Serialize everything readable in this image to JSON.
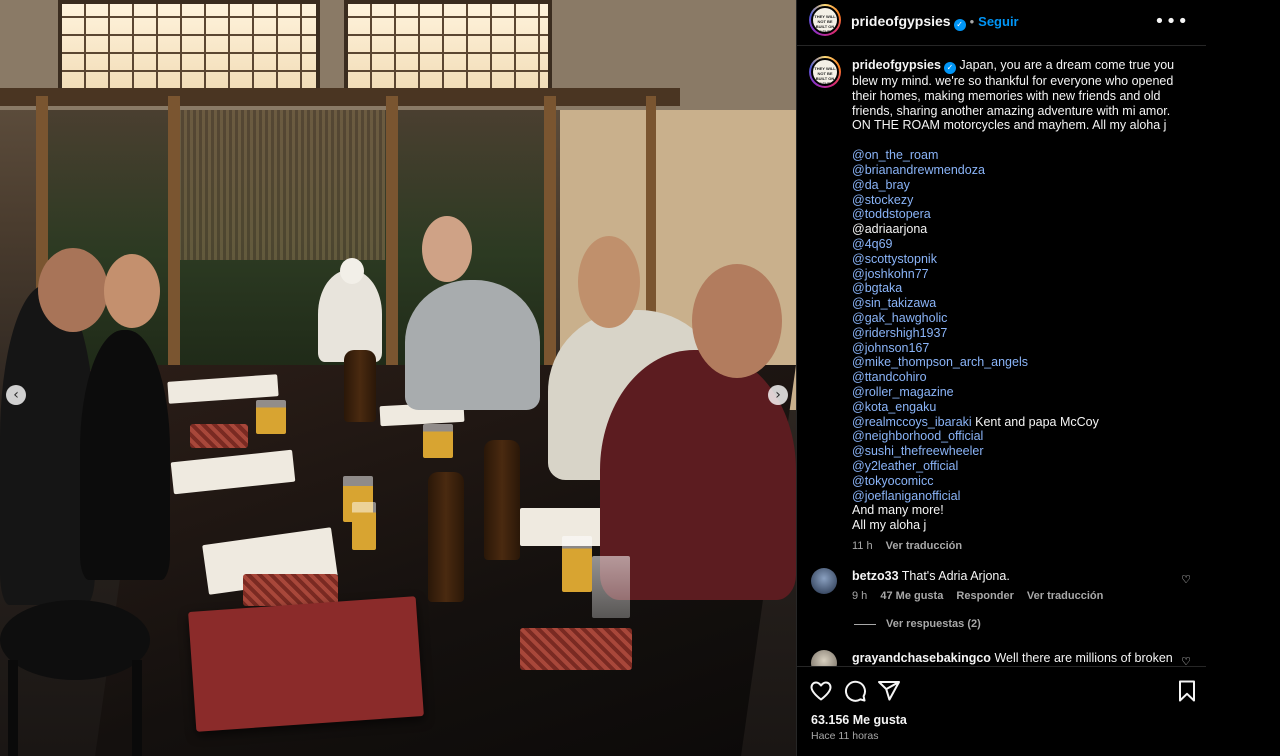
{
  "post": {
    "author": "prideofgypsies",
    "follow_label": "Seguir",
    "dot": "•",
    "more_label": "•••",
    "avatar_text": "THEY WILL NOT BE BUILT ON HASHED MACHINES",
    "verified_mark": "✓",
    "caption_text": "Japan, you are a dream come true you blew my mind. we're so thankful for everyone who opened their homes, making memories with new friends and old friends, sharing another amazing adventure with mi amor. ON THE ROAM motorcycles and mayhem. All my aloha j",
    "mention_lines": [
      {
        "text": "@on_the_roam",
        "type": "mention"
      },
      {
        "text": "@brianandrewmendoza",
        "type": "mention"
      },
      {
        "text": "@da_bray",
        "type": "mention"
      },
      {
        "text": "@stockezy",
        "type": "mention"
      },
      {
        "text": "@toddstopera",
        "type": "mention"
      },
      {
        "text": "@adriaarjona",
        "type": "plain"
      },
      {
        "text": "@4q69",
        "type": "mention"
      },
      {
        "text": "@scottystopnik",
        "type": "mention"
      },
      {
        "text": "@joshkohn77",
        "type": "mention"
      },
      {
        "text": "@bgtaka",
        "type": "mention"
      },
      {
        "text": "@sin_takizawa",
        "type": "mention"
      },
      {
        "text": "@gak_hawgholic",
        "type": "mention"
      },
      {
        "text": "@ridershigh1937",
        "type": "mention"
      },
      {
        "text": "@johnson167",
        "type": "mention"
      },
      {
        "text": "@mike_thompson_arch_angels",
        "type": "mention"
      },
      {
        "text": "@ttandcohiro",
        "type": "mention"
      },
      {
        "text": "@roller_magazine",
        "type": "mention"
      },
      {
        "text": "@kota_engaku",
        "type": "mention"
      },
      {
        "text": "@realmccoys_ibaraki",
        "type": "mention",
        "suffix": " Kent and papa McCoy"
      },
      {
        "text": "@neighborhood_official",
        "type": "mention"
      },
      {
        "text": "@sushi_thefreewheeler",
        "type": "mention"
      },
      {
        "text": "@y2leather_official",
        "type": "mention"
      },
      {
        "text": "@tokyocomicc",
        "type": "mention"
      },
      {
        "text": "@joeflaniganofficial",
        "type": "mention"
      },
      {
        "text": "And many more!",
        "type": "plain"
      },
      {
        "text": "All my aloha j",
        "type": "plain"
      }
    ],
    "caption_time": "11 h",
    "caption_translate": "Ver traducción"
  },
  "comments": [
    {
      "user": "betzo33",
      "text": "That's Adria Arjona.",
      "time": "9 h",
      "likes": "47 Me gusta",
      "reply_label": "Responder",
      "translate_label": "Ver traducción",
      "replies_label": "Ver respuestas (2)"
    },
    {
      "user": "grayandchasebakingco",
      "text": "Well there are millions of broken"
    }
  ],
  "footer": {
    "likes": "63.156 Me gusta",
    "time_ago": "Hace 11 horas"
  },
  "icons": {
    "heart": "heart-icon",
    "comment": "comment-icon",
    "share": "share-icon",
    "save": "bookmark-icon"
  },
  "carousel": {
    "prev": "‹",
    "next": "›"
  }
}
